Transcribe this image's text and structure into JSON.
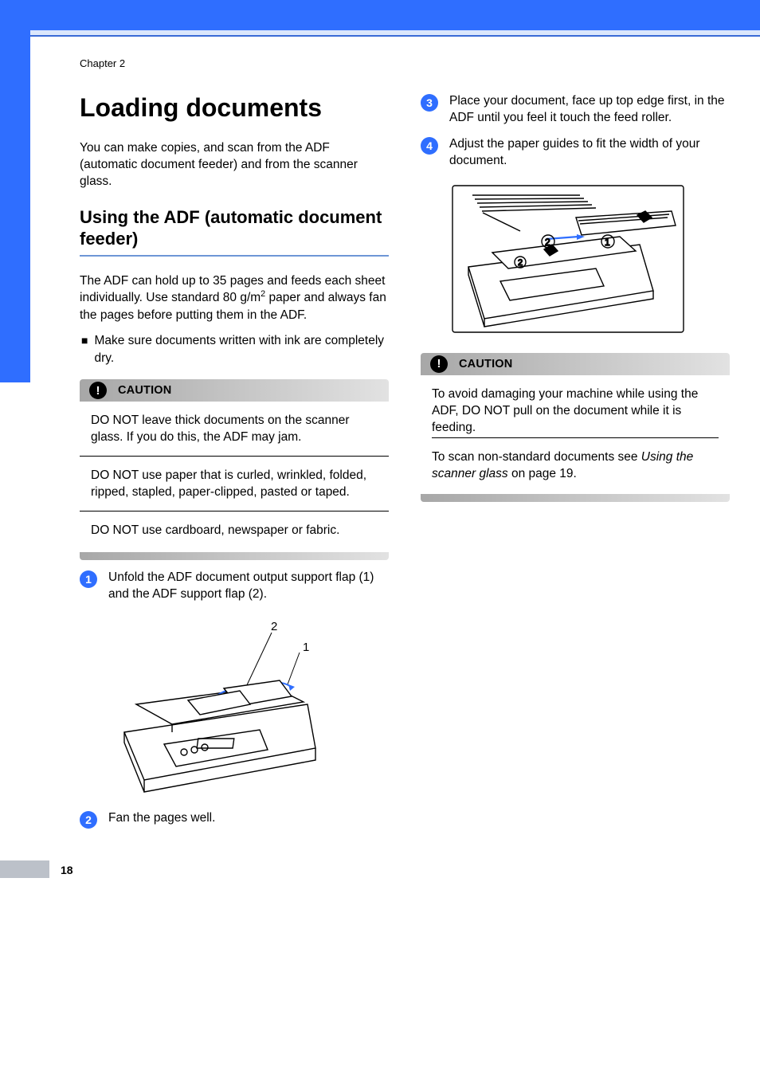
{
  "chapter_label": "Chapter 2",
  "page_number": "18",
  "left_col": {
    "main_heading": "Loading documents",
    "intro": "You can make copies, and scan from the ADF (automatic document feeder) and from the scanner glass.",
    "sub_heading": "Using the ADF (automatic document feeder)",
    "adf_desc_prefix": "The ADF can hold up to 35 pages and feeds each sheet individually. Use standard 80 g/m",
    "adf_desc_suffix": " paper and always fan the pages before putting them in the ADF.",
    "bullet1": "Make sure documents written with ink are completely dry.",
    "caution_label": "CAUTION",
    "caution_items": [
      "DO NOT leave thick documents on the scanner glass. If you do this, the ADF may jam.",
      "DO NOT use paper that is curled, wrinkled, folded, ripped, stapled, paper-clipped, pasted or taped.",
      "DO NOT use cardboard, newspaper or fabric."
    ],
    "step1_num": "1",
    "step1_text": "Unfold the ADF document output support flap (1) and the ADF support flap (2).",
    "step2_num": "2",
    "step2_text": "Fan the pages well.",
    "fig1_label1": "1",
    "fig1_label2": "2"
  },
  "right_col": {
    "step3_num": "3",
    "step3_text": "Place your document, face up top edge first, in the ADF until you feel it touch the feed roller.",
    "step4_num": "4",
    "step4_text": "Adjust the paper guides to fit the width of your document.",
    "caution_label": "CAUTION",
    "caution_body": "To avoid damaging your machine while using the ADF, DO NOT pull on the document while it is feeding.",
    "cross_ref_prefix": "To scan non-standard documents see ",
    "cross_ref_italic": "Using the scanner glass",
    "cross_ref_suffix": " on page 19."
  }
}
